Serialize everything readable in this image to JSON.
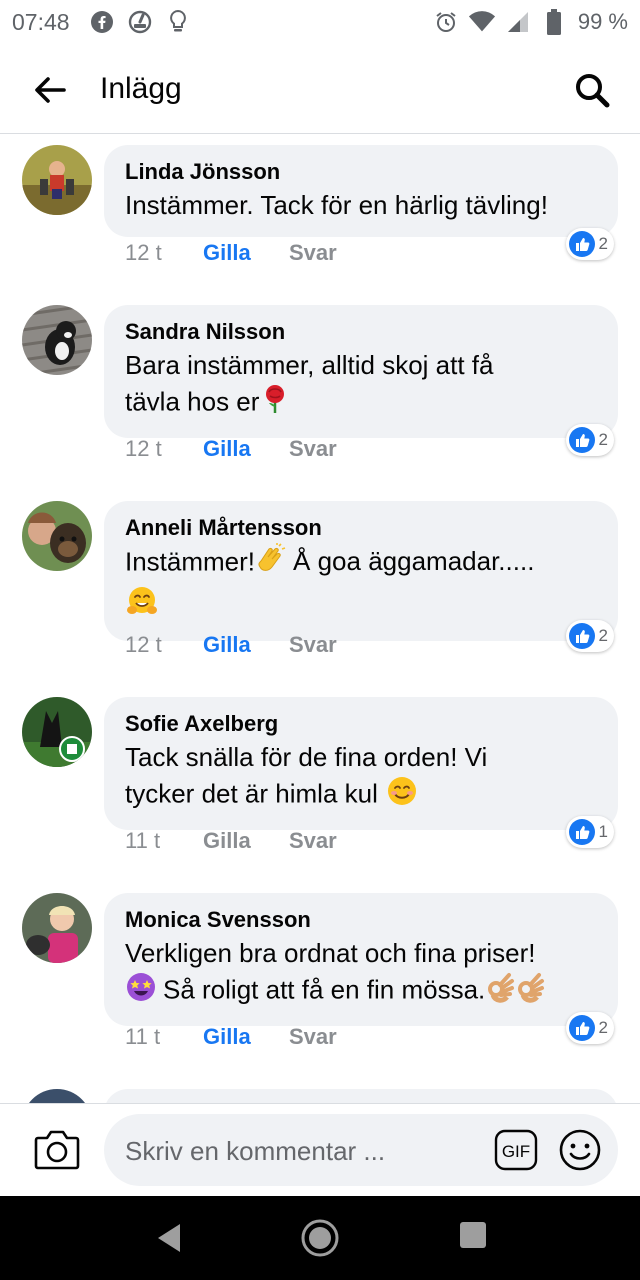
{
  "status_bar": {
    "time": "07:48",
    "battery": "99 %",
    "icons": [
      "facebook-icon",
      "speedometer-icon",
      "lightbulb-icon",
      "alarm-icon",
      "wifi-icon",
      "signal-icon",
      "battery-icon"
    ]
  },
  "header": {
    "title": "Inlägg",
    "back_icon": "arrow-left-icon",
    "search_icon": "search-icon"
  },
  "comments": [
    {
      "author": "Linda Jönsson",
      "lines": [
        "Instämmer. Tack för en härlig tävling!"
      ],
      "age": "12 t",
      "like_label": "Gilla",
      "like_active": true,
      "reply_label": "Svar",
      "reactions": "2"
    },
    {
      "author": "Sandra Nilsson",
      "lines": [
        "Bara instämmer, alltid skoj att få",
        "tävla hos er"
      ],
      "age": "12 t",
      "like_label": "Gilla",
      "like_active": true,
      "reply_label": "Svar",
      "reactions": "2"
    },
    {
      "author": "Anneli Mårtensson",
      "lines": [
        "Instämmer!",
        "Å goa äggamadar....."
      ],
      "age": "12 t",
      "like_label": "Gilla",
      "like_active": true,
      "reply_label": "Svar",
      "reactions": "2"
    },
    {
      "author": "Sofie Axelberg",
      "lines": [
        "Tack snälla för de fina orden! Vi",
        "tycker det är himla kul"
      ],
      "age": "11 t",
      "like_label": "Gilla",
      "like_active": false,
      "reply_label": "Svar",
      "reactions": "1"
    },
    {
      "author": "Monica Svensson",
      "lines": [
        "Verkligen bra ordnat och fina priser!",
        "Så roligt att få en fin mössa."
      ],
      "age": "11 t",
      "like_label": "Gilla",
      "like_active": true,
      "reply_label": "Svar",
      "reactions": "2"
    }
  ],
  "composer": {
    "placeholder": "Skriv en kommentar ...",
    "gif_label": "GIF"
  },
  "colors": {
    "accent": "#1877f2",
    "bubble": "#f0f2f5",
    "muted": "#8a8d91"
  }
}
